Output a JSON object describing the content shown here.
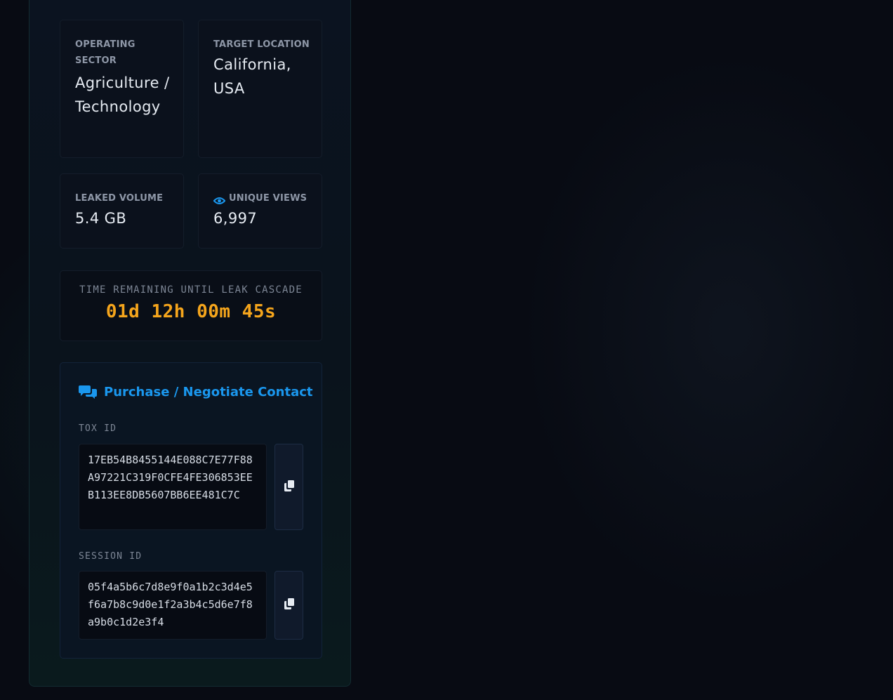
{
  "details": {
    "sector_label": "OPERATING SECTOR",
    "sector_value": "Agriculture / Technology",
    "location_label": "TARGET LOCATION",
    "location_value": "California, USA",
    "volume_label": "LEAKED VOLUME",
    "volume_value": "5.4 GB",
    "views_label": "UNIQUE VIEWS",
    "views_value": "6,997"
  },
  "countdown": {
    "label": "TIME REMAINING UNTIL LEAK CASCADE",
    "value": "01d 12h 00m 45s"
  },
  "contact": {
    "title": "Purchase / Negotiate Contact",
    "tox_label": "TOX ID",
    "tox_value": "17EB54B8455144E088C7E77F88A97221C319F0CFE4FE306853EEB113EE8DB5607BB6EE481C7C",
    "session_label": "SESSION ID",
    "session_value": "05f4a5b6c7d8e9f0a1b2c3d4e5f6a7b8c9d0e1f2a3b4c5d6e7f8a9b0c1d2e3f4"
  },
  "icons": {
    "views": "eye-icon",
    "contact": "chat-bubbles-icon",
    "copy": "copy-icon"
  },
  "colors": {
    "accent_blue": "#1a97ee",
    "countdown_orange": "#f5a51c",
    "background": "#080b13"
  }
}
